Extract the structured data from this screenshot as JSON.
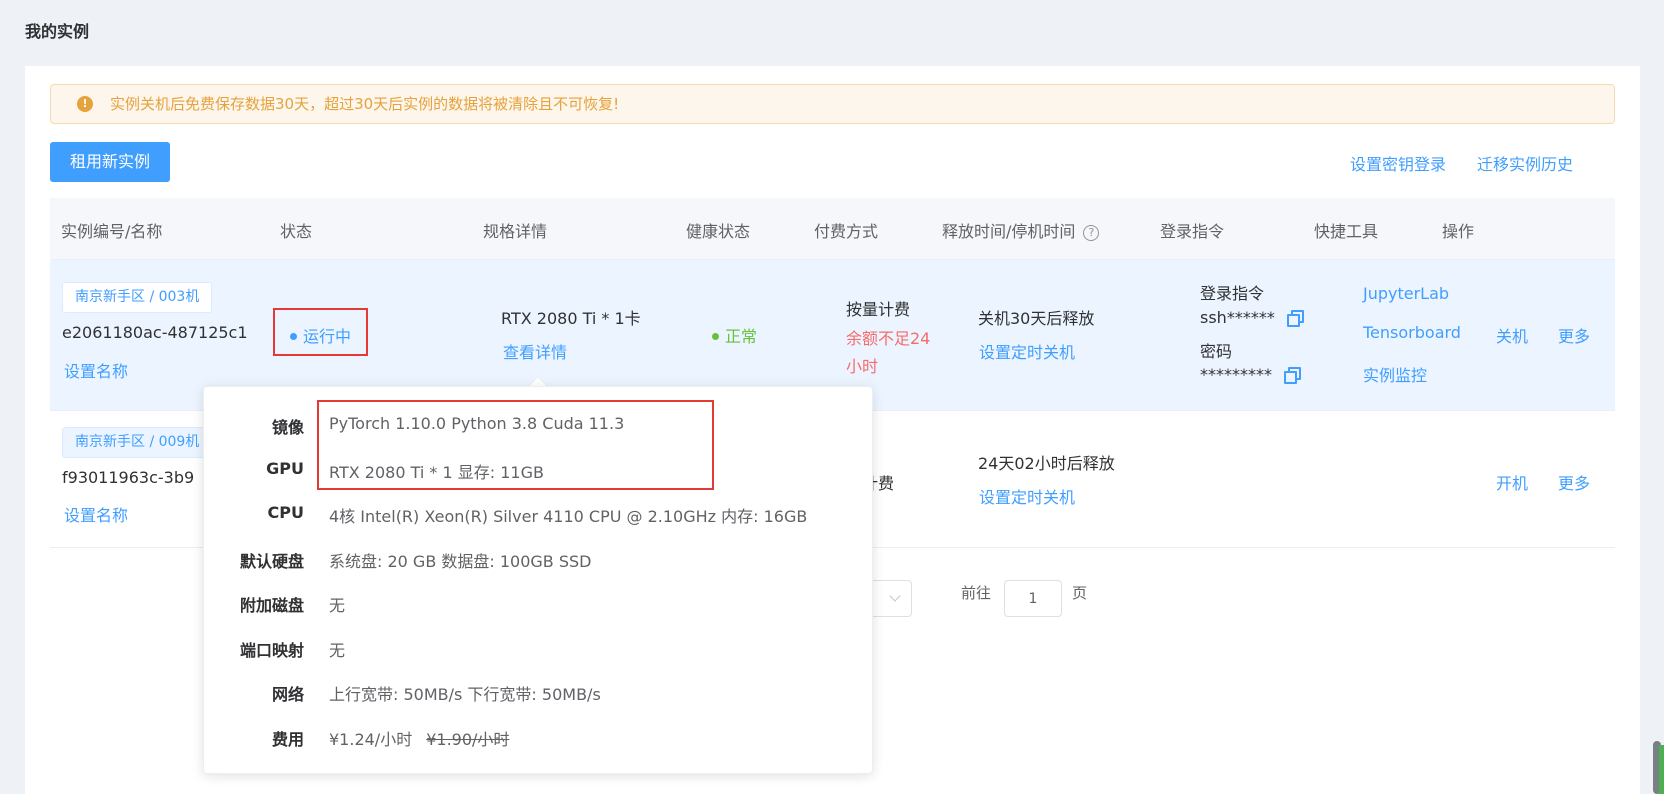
{
  "page": {
    "title": "我的实例"
  },
  "alert": {
    "text": "实例关机后免费保存数据30天，超过30天后实例的数据将被清除且不可恢复!"
  },
  "toolbar": {
    "rent_button": "租用新实例",
    "ssh_key_link": "设置密钥登录",
    "migration_history_link": "迁移实例历史"
  },
  "table": {
    "headers": {
      "id_name": "实例编号/名称",
      "status": "状态",
      "spec": "规格详情",
      "health": "健康状态",
      "billing": "付费方式",
      "release_time": "释放时间/停机时间",
      "login": "登录指令",
      "tools": "快捷工具",
      "actions": "操作"
    },
    "rows": [
      {
        "region_tag": "南京新手区 / 003机",
        "id": "e2061180ac-487125c1",
        "rename_link": "设置名称",
        "status": "运行中",
        "spec": "RTX 2080 Ti * 1卡",
        "spec_detail_link": "查看详情",
        "health": "正常",
        "billing": "按量计费",
        "billing_warning_line1": "余额不足24",
        "billing_warning_line2": "小时",
        "release": "关机30天后释放",
        "timer_link": "设置定时关机",
        "login_label": "登录指令",
        "login_value": "ssh******",
        "password_label": "密码",
        "password_value": "*********",
        "tools": [
          "JupyterLab",
          "Tensorboard",
          "实例监控"
        ],
        "action_power": "关机",
        "action_more": "更多"
      },
      {
        "region_tag": "南京新手区 / 009机",
        "id": "f93011963c-3b9",
        "rename_link": "设置名称",
        "billing_partial": "量计费",
        "release": "24天02小时后释放",
        "timer_link": "设置定时关机",
        "action_power": "开机",
        "action_more": "更多"
      }
    ]
  },
  "pagination": {
    "goto_label": "前往",
    "page_value": "1",
    "page_suffix": "页"
  },
  "popover": {
    "image_label": "镜像",
    "image_value": "PyTorch  1.10.0     Python  3.8     Cuda  11.3",
    "gpu_label": "GPU",
    "gpu_value": "RTX 2080 Ti * 1     显存:  11GB",
    "cpu_label": "CPU",
    "cpu_value": "4核 Intel(R) Xeon(R) Silver 4110 CPU @ 2.10GHz     内存:  16GB",
    "disk_label": "默认硬盘",
    "disk_value": "系统盘:  20 GB     数据盘:  100GB SSD",
    "extra_disk_label": "附加磁盘",
    "extra_disk_value": "无",
    "port_label": "端口映射",
    "port_value": "无",
    "network_label": "网络",
    "network_value": "上行宽带:  50MB/s     下行宽带:  50MB/s",
    "fee_label": "费用",
    "fee_value": "¥1.24/小时",
    "fee_original": "¥1.90/小时"
  },
  "colors": {
    "primary": "#409eff",
    "success": "#67c23a",
    "danger": "#f56c6c",
    "warning": "#e6a23c",
    "highlight_box": "#e53935"
  }
}
